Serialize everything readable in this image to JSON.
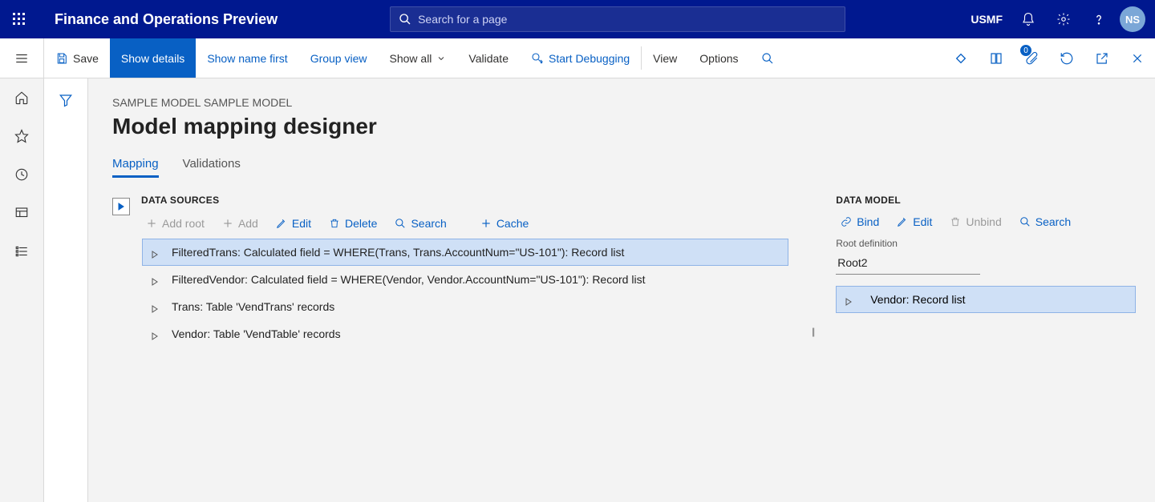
{
  "top": {
    "app_title": "Finance and Operations Preview",
    "search_placeholder": "Search for a page",
    "company": "USMF",
    "avatar": "NS"
  },
  "cmd": {
    "save": "Save",
    "show_details": "Show details",
    "show_name_first": "Show name first",
    "group_view": "Group view",
    "show_all": "Show all",
    "validate": "Validate",
    "start_debugging": "Start Debugging",
    "view": "View",
    "options": "Options",
    "attach_badge": "0"
  },
  "page": {
    "breadcrumb": "SAMPLE MODEL SAMPLE MODEL",
    "title": "Model mapping designer",
    "tabs": {
      "mapping": "Mapping",
      "validations": "Validations"
    }
  },
  "ds": {
    "heading": "DATA SOURCES",
    "toolbar": {
      "add_root": "Add root",
      "add": "Add",
      "edit": "Edit",
      "delete": "Delete",
      "search": "Search",
      "cache": "Cache"
    },
    "rows": [
      "FilteredTrans: Calculated field = WHERE(Trans, Trans.AccountNum=\"US-101\"): Record list",
      "FilteredVendor: Calculated field = WHERE(Vendor, Vendor.AccountNum=\"US-101\"): Record list",
      "Trans: Table 'VendTrans' records",
      "Vendor: Table 'VendTable' records"
    ]
  },
  "dm": {
    "heading": "DATA MODEL",
    "toolbar": {
      "bind": "Bind",
      "edit": "Edit",
      "unbind": "Unbind",
      "search": "Search"
    },
    "root_label": "Root definition",
    "root_value": "Root2",
    "rows": [
      "Vendor: Record list"
    ]
  }
}
